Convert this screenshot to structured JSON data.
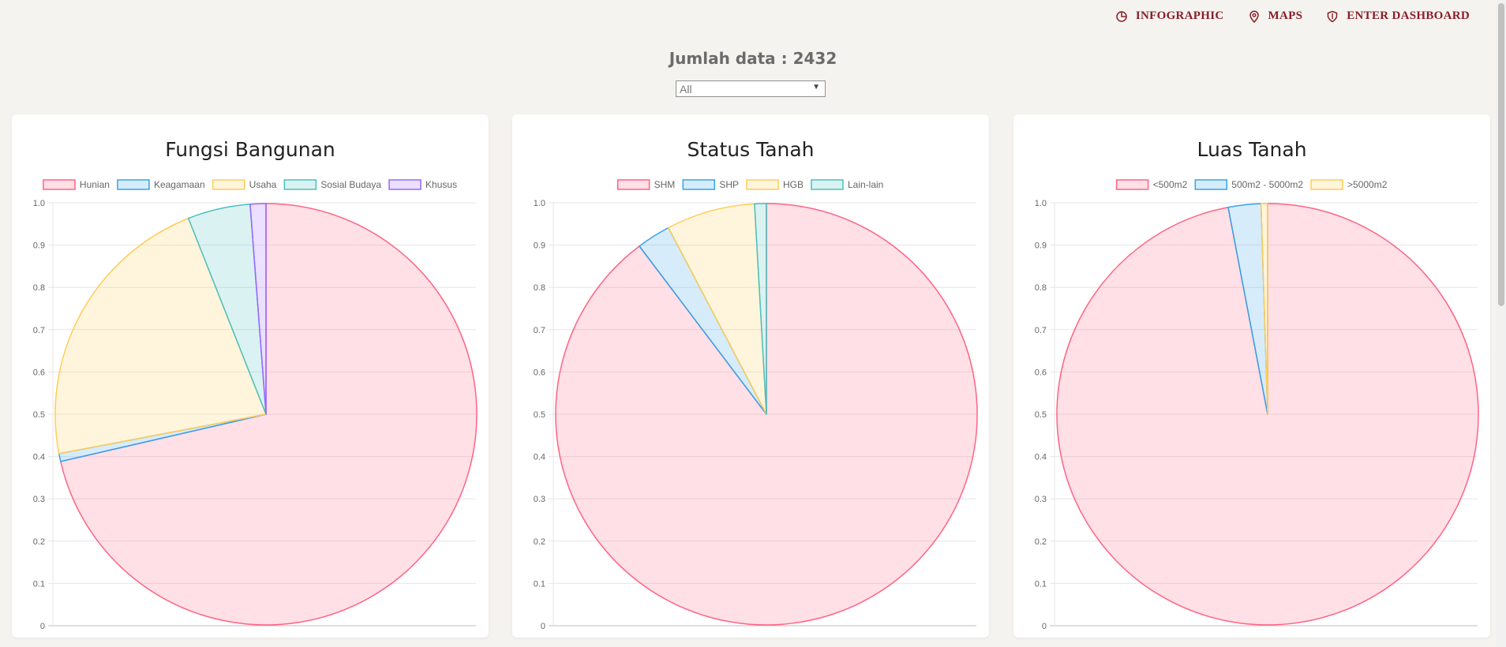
{
  "nav": {
    "items": [
      {
        "label": "INFOGRAPHIC",
        "icon": "pie-chart-icon"
      },
      {
        "label": "MAPS",
        "icon": "map-pin-icon"
      },
      {
        "label": "ENTER DASHBOARD",
        "icon": "shield-icon"
      }
    ]
  },
  "summary": {
    "title": "Jumlah data : 2432"
  },
  "filter": {
    "selected": "All"
  },
  "colors": {
    "nav": "#8b1c25",
    "red": "#ff6384",
    "blue": "#36a2eb",
    "yellow": "#ffcd56",
    "teal": "#4bc0c0",
    "purple": "#9966ff"
  },
  "chart_data": [
    {
      "type": "pie",
      "title": "Fungsi Bangunan",
      "legend_position": "top",
      "grid": true,
      "ylim": [
        0,
        1
      ],
      "y_ticks": [
        "1.0",
        "0.9",
        "0.8",
        "0.7",
        "0.6",
        "0.5",
        "0.4",
        "0.3",
        "0.2",
        "0.1",
        "0"
      ],
      "categories": [
        "Hunian",
        "Keagamaan",
        "Usaha",
        "Sosial Budaya",
        "Khusus"
      ],
      "values": [
        0.714,
        0.006,
        0.22,
        0.048,
        0.012
      ],
      "colors": [
        "#ff6384",
        "#36a2eb",
        "#ffcd56",
        "#4bc0c0",
        "#9966ff"
      ]
    },
    {
      "type": "pie",
      "title": "Status Tanah",
      "legend_position": "top",
      "grid": true,
      "ylim": [
        0,
        1
      ],
      "y_ticks": [
        "1.0",
        "0.9",
        "0.8",
        "0.7",
        "0.6",
        "0.5",
        "0.4",
        "0.3",
        "0.2",
        "0.1",
        "0"
      ],
      "categories": [
        "SHM",
        "SHP",
        "HGB",
        "Lain-lain"
      ],
      "values": [
        0.897,
        0.026,
        0.068,
        0.009
      ],
      "colors": [
        "#ff6384",
        "#36a2eb",
        "#ffcd56",
        "#4bc0c0"
      ]
    },
    {
      "type": "pie",
      "title": "Luas Tanah",
      "legend_position": "top",
      "grid": true,
      "ylim": [
        0,
        1
      ],
      "y_ticks": [
        "1.0",
        "0.9",
        "0.8",
        "0.7",
        "0.6",
        "0.5",
        "0.4",
        "0.3",
        "0.2",
        "0.1",
        "0"
      ],
      "categories": [
        "<500m2",
        "500m2 - 5000m2",
        ">5000m2"
      ],
      "values": [
        0.97,
        0.025,
        0.005
      ],
      "colors": [
        "#ff6384",
        "#36a2eb",
        "#ffcd56"
      ]
    }
  ]
}
